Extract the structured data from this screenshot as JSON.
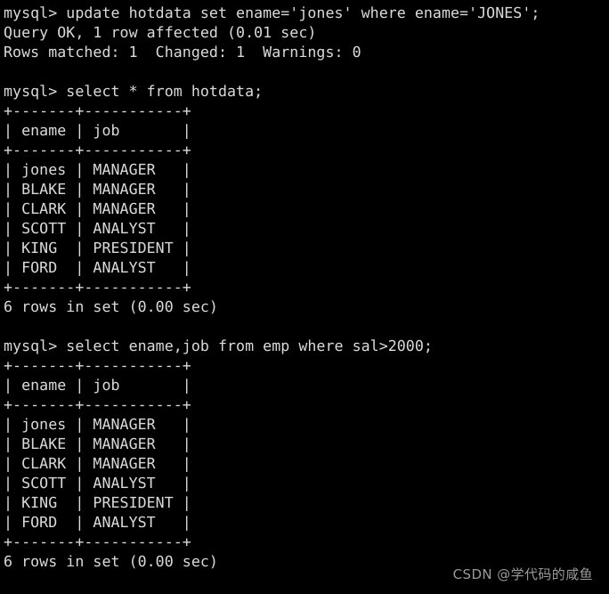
{
  "terminal": {
    "background_color": "#000000",
    "text_color": "#d9d9d9",
    "prompt": "mysql>",
    "lines": [
      "mysql> update hotdata set ename='jones' where ename='JONES';",
      "Query OK, 1 row affected (0.01 sec)",
      "Rows matched: 1  Changed: 1  Warnings: 0",
      "",
      "mysql> select * from hotdata;",
      "+-------+-----------+",
      "| ename | job       |",
      "+-------+-----------+",
      "| jones | MANAGER   |",
      "| BLAKE | MANAGER   |",
      "| CLARK | MANAGER   |",
      "| SCOTT | ANALYST   |",
      "| KING  | PRESIDENT |",
      "| FORD  | ANALYST   |",
      "+-------+-----------+",
      "6 rows in set (0.00 sec)",
      "",
      "mysql> select ename,job from emp where sal>2000;",
      "+-------+-----------+",
      "| ename | job       |",
      "+-------+-----------+",
      "| jones | MANAGER   |",
      "| BLAKE | MANAGER   |",
      "| CLARK | MANAGER   |",
      "| SCOTT | ANALYST   |",
      "| KING  | PRESIDENT |",
      "| FORD  | ANALYST   |",
      "+-------+-----------+",
      "6 rows in set (0.00 sec)"
    ],
    "statements": [
      {
        "command": "update hotdata set ename='jones' where ename='JONES';",
        "result_lines": [
          "Query OK, 1 row affected (0.01 sec)",
          "Rows matched: 1  Changed: 1  Warnings: 0"
        ]
      },
      {
        "command": "select * from hotdata;",
        "columns": [
          "ename",
          "job"
        ],
        "rows": [
          [
            "jones",
            "MANAGER"
          ],
          [
            "BLAKE",
            "MANAGER"
          ],
          [
            "CLARK",
            "MANAGER"
          ],
          [
            "SCOTT",
            "ANALYST"
          ],
          [
            "KING",
            "PRESIDENT"
          ],
          [
            "FORD",
            "ANALYST"
          ]
        ],
        "status": "6 rows in set (0.00 sec)"
      },
      {
        "command": "select ename,job from emp where sal>2000;",
        "columns": [
          "ename",
          "job"
        ],
        "rows": [
          [
            "jones",
            "MANAGER"
          ],
          [
            "BLAKE",
            "MANAGER"
          ],
          [
            "CLARK",
            "MANAGER"
          ],
          [
            "SCOTT",
            "ANALYST"
          ],
          [
            "KING",
            "PRESIDENT"
          ],
          [
            "FORD",
            "ANALYST"
          ]
        ],
        "status": "6 rows in set (0.00 sec)"
      }
    ]
  },
  "watermark": {
    "text": "CSDN @学代码的咸鱼",
    "color": "#9a9a9a"
  }
}
